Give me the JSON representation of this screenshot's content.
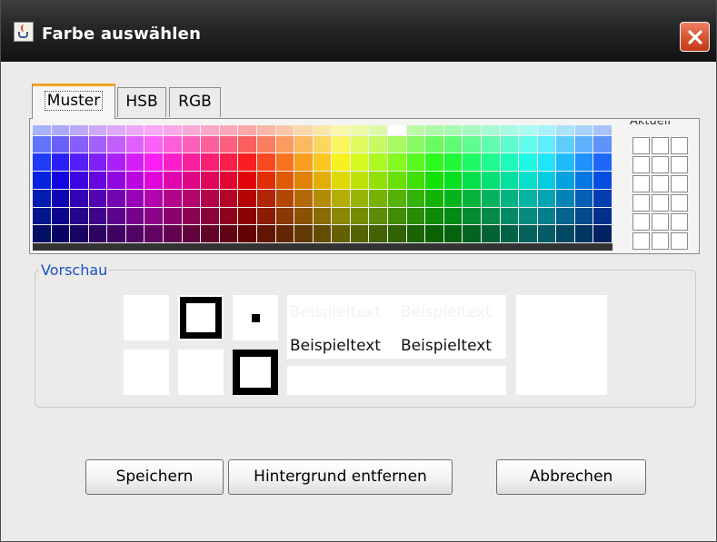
{
  "window": {
    "title": "Farbe auswählen"
  },
  "tabs": [
    {
      "label": "Muster",
      "selected": true
    },
    {
      "label": "HSB",
      "selected": false
    },
    {
      "label": "RGB",
      "selected": false
    }
  ],
  "swatches": {
    "rows": 7,
    "cols": 31,
    "selected": {
      "row": 0,
      "col": 19
    }
  },
  "recent": {
    "label": "Aktuell"
  },
  "preview": {
    "label": "Vorschau",
    "sample_text": "Beispieltext"
  },
  "buttons": {
    "save": "Speichern",
    "remove_background": "Hintergrund entfernen",
    "cancel": "Abbrechen"
  },
  "colors": {
    "title_bar": "#202020",
    "close_button": "#d6512e",
    "preview_label": "#1a4fc7",
    "selected_tab_accent": "#f3a528"
  }
}
